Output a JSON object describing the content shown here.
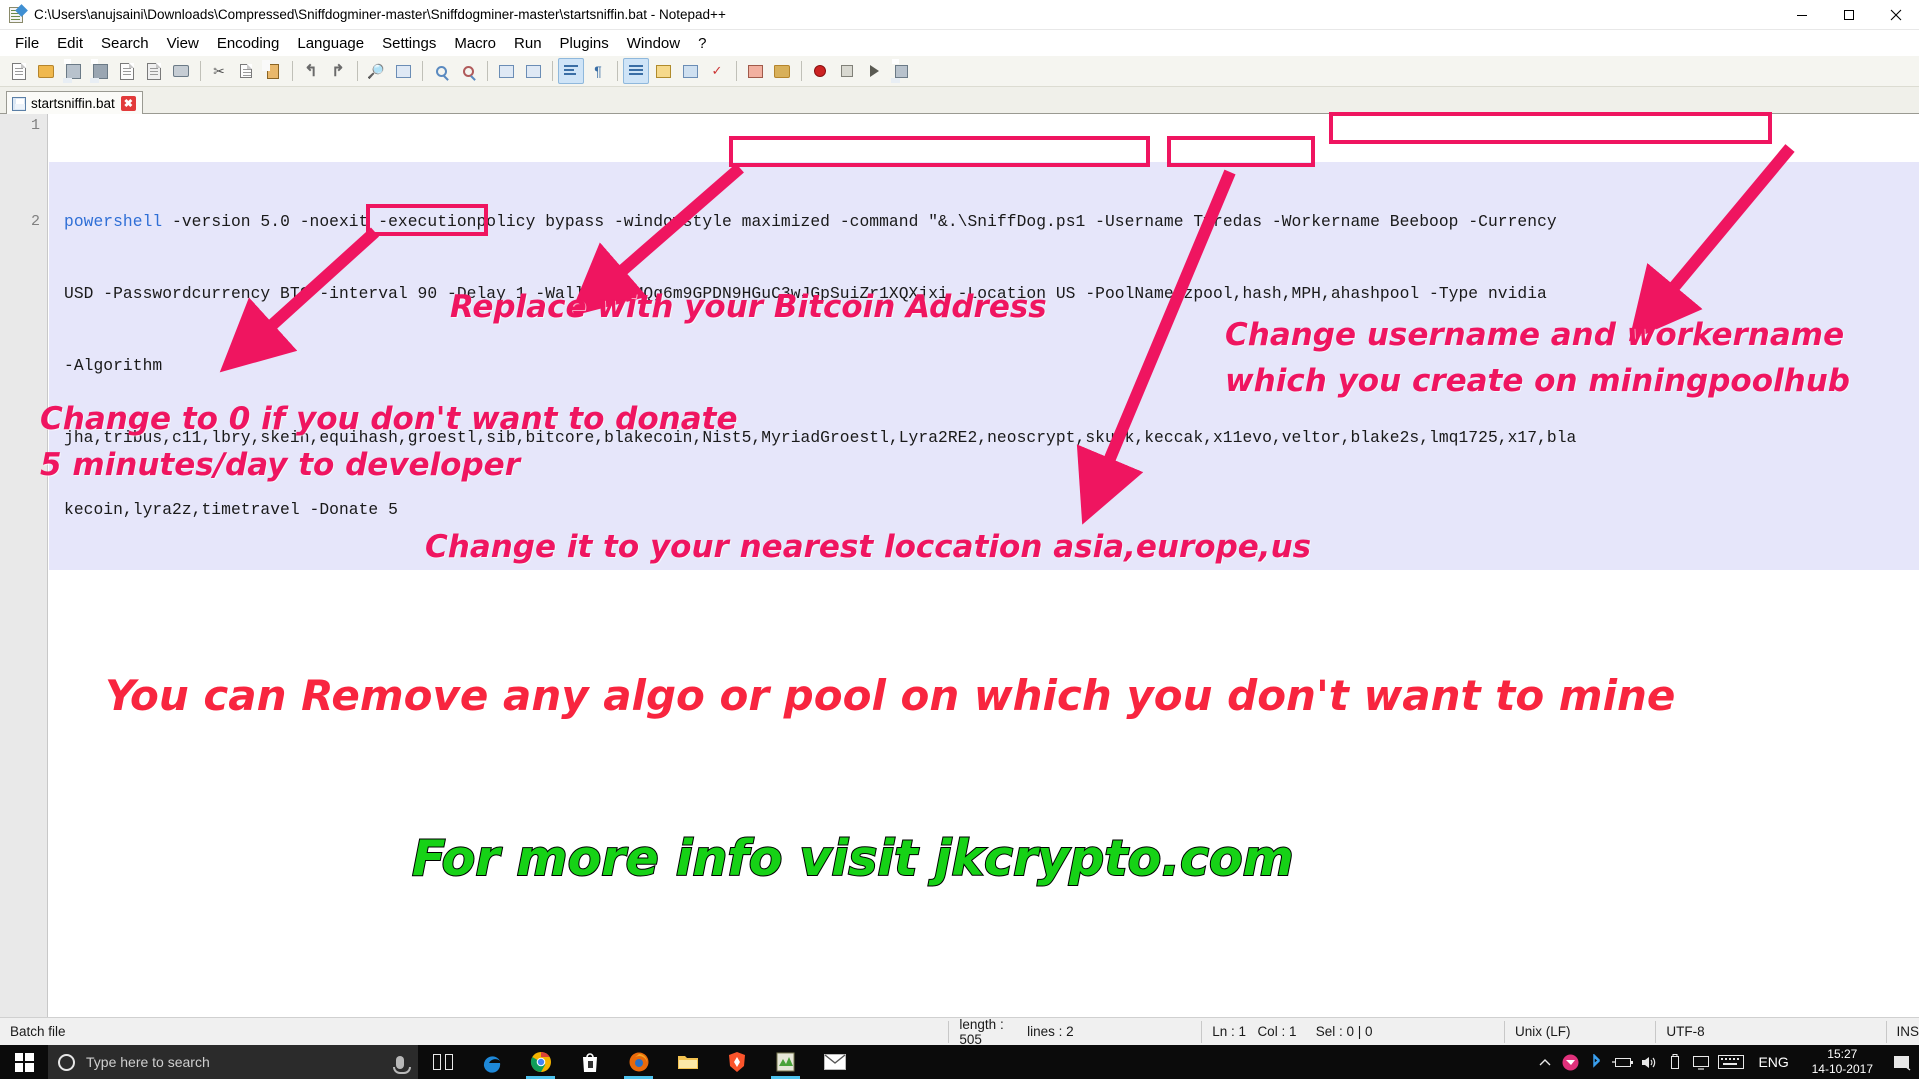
{
  "window": {
    "title": "C:\\Users\\anujsaini\\Downloads\\Compressed\\Sniffdogminer-master\\Sniffdogminer-master\\startsniffin.bat - Notepad++",
    "icon": "notepad-plus-plus-icon",
    "minimize_label": "Minimize",
    "maximize_label": "Restore",
    "close_label": "Close"
  },
  "menu": {
    "items": [
      "File",
      "Edit",
      "Search",
      "View",
      "Encoding",
      "Language",
      "Settings",
      "Macro",
      "Run",
      "Plugins",
      "Window",
      "?"
    ]
  },
  "toolbar": {
    "buttons": [
      "new-file-icon",
      "open-file-icon",
      "save-icon",
      "save-all-icon",
      "close-file-icon",
      "close-all-icon",
      "print-icon",
      "cut-icon",
      "copy-icon",
      "paste-icon",
      "undo-icon",
      "redo-icon",
      "find-icon",
      "replace-icon",
      "zoom-in-icon",
      "zoom-out-icon",
      "sync-vertical-icon",
      "sync-horizontal-icon",
      "word-wrap-icon",
      "show-all-chars-icon",
      "indent-guide-icon",
      "ui-contrast-icon",
      "user-defined-dialog-icon",
      "document-map-icon",
      "function-list-icon",
      "folder-as-workspace-icon",
      "macro-record-icon",
      "macro-stop-icon",
      "macro-play-icon",
      "macro-save-icon"
    ]
  },
  "tab": {
    "label": "startsniffin.bat",
    "icon": "saved-document-icon",
    "close_label": "✖"
  },
  "editor": {
    "line_numbers": [
      "1",
      "2"
    ],
    "code_segments": [
      {
        "text": "powershell",
        "kind": "keyword"
      },
      {
        "text": " -version 5.0 -noexit -executionpolicy bypass -windowstyle maximized -command \"&.\\SniffDog.ps1 -Username Tyredas -Workername Beeboop -Currency USD -Passwordcurrency BTC -interval 90 -Delay 1 -Wallet 1AMQg6m9GPDN9HGuC3wJGpSuiZr1XQXjxi -Location US -PoolName zpool,hash,MPH,ahashpool -Type nvidia -Algorithm jha,tribus,c11,lbry,skein,equihash,groestl,sib,bitcore,blakecoin,Nist5,MyriadGroestl,Lyra2RE2,neoscrypt,skunk,keccak,x11evo,veltor,blake2s,lmq1725,x17,blakecoin,lyra2z,timetravel -Donate 5",
        "kind": "plain"
      }
    ],
    "wrapped_lines": [
      {
        "prefix_keyword": "powershell",
        "rest": " -version 5.0 -noexit -executionpolicy bypass -windowstyle maximized -command \"&.\\SniffDog.ps1 -Username Tyredas -Workername Beeboop -Currency"
      },
      {
        "prefix_keyword": "",
        "rest": "USD -Passwordcurrency BTC -interval 90 -Delay 1 -Wallet 1AMQg6m9GPDN9HGuC3wJGpSuiZr1XQXjxi -Location US -PoolName zpool,hash,MPH,ahashpool -Type nvidia"
      },
      {
        "prefix_keyword": "",
        "rest": "-Algorithm"
      },
      {
        "prefix_keyword": "",
        "rest": "jha,tribus,c11,lbry,skein,equihash,groestl,sib,bitcore,blakecoin,Nist5,MyriadGroestl,Lyra2RE2,neoscrypt,skunk,keccak,x11evo,veltor,blake2s,lmq1725,x17,bla"
      },
      {
        "prefix_keyword": "",
        "rest": "kecoin,lyra2z,timetravel -Donate 5"
      }
    ]
  },
  "annotations": {
    "highlight_boxes": [
      {
        "name": "username-workername-highlight",
        "text": "-Username Tyredas -Workername Beeboop"
      },
      {
        "name": "wallet-address-highlight",
        "text": "1AMQg6m9GPDN9HGuC3wJGpSuiZr1XQXjxi"
      },
      {
        "name": "location-highlight",
        "text": "-Location US"
      },
      {
        "name": "donate-highlight",
        "text": "-Donate 5"
      }
    ],
    "callouts": [
      {
        "name": "callout-bitcoin-address",
        "text": "Replace with your Bitcoin Address",
        "color": "#ef1560"
      },
      {
        "name": "callout-username-workername",
        "line1": "Change username and workername",
        "line2": "which you create on miningpoolhub",
        "color": "#ef1560"
      },
      {
        "name": "callout-donate",
        "line1": "Change to 0 if you don't want to donate",
        "line2": "5 minutes/day to developer",
        "color": "#ef1560"
      },
      {
        "name": "callout-location",
        "text": "Change it to your nearest loccation asia,europe,us",
        "color": "#ef1560"
      },
      {
        "name": "callout-remove-algo",
        "text": "You can Remove any algo or pool on which you don't want to mine",
        "color": "#f8253f"
      },
      {
        "name": "callout-more-info",
        "text": "For more info visit jkcrypto.com",
        "color": "#16d216"
      }
    ]
  },
  "statusbar": {
    "file_type": "Batch file",
    "length": "length : 505",
    "lines": "lines : 2",
    "ln": "Ln : 1",
    "col": "Col : 1",
    "sel": "Sel : 0 | 0",
    "eol": "Unix (LF)",
    "encoding": "UTF-8",
    "insert_mode": "INS"
  },
  "taskbar": {
    "start_label": "Start",
    "search_placeholder": "Type here to search",
    "mic_icon": "microphone-icon",
    "cortana_icon": "cortana-circle-icon",
    "apps": [
      {
        "name": "task-view-icon",
        "label": "Task View"
      },
      {
        "name": "edge-icon",
        "label": "Microsoft Edge"
      },
      {
        "name": "chrome-icon",
        "label": "Google Chrome"
      },
      {
        "name": "store-icon",
        "label": "Microsoft Store"
      },
      {
        "name": "firefox-icon",
        "label": "Mozilla Firefox"
      },
      {
        "name": "file-explorer-icon",
        "label": "File Explorer"
      },
      {
        "name": "brave-icon",
        "label": "Brave"
      },
      {
        "name": "notepad-plus-plus-taskbar-icon",
        "label": "Notepad++"
      },
      {
        "name": "mail-icon",
        "label": "Mail"
      }
    ],
    "tray": {
      "show_hidden": "show-hidden-icons-chevron",
      "icons": [
        "hangouts-icon",
        "bluetooth-icon",
        "battery-icon",
        "volume-icon",
        "usb-icon",
        "display-icon",
        "keyboard-icon"
      ],
      "language": "ENG",
      "time": "15:27",
      "date": "14-10-2017",
      "action_center": "action-center-icon"
    }
  }
}
